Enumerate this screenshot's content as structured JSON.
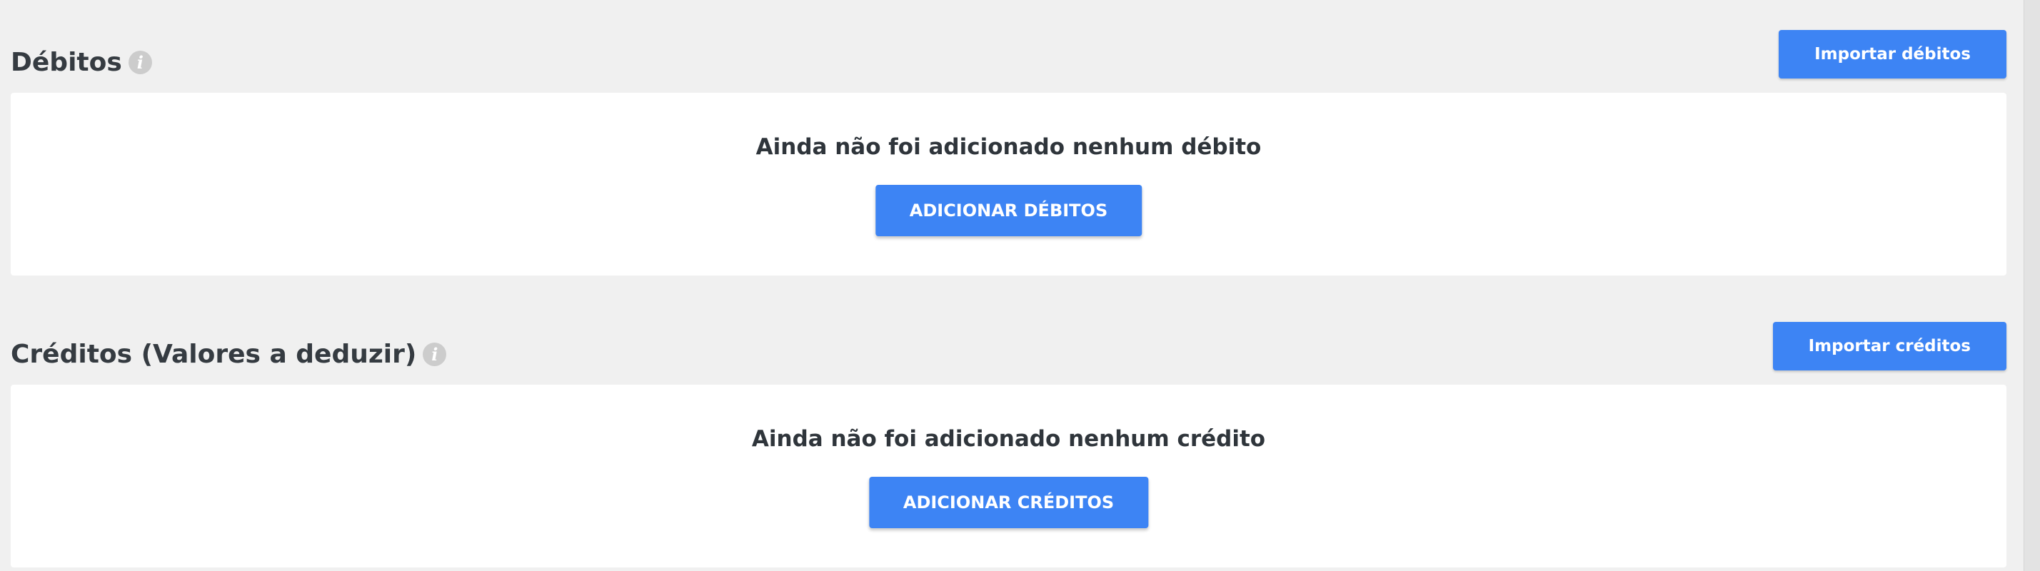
{
  "debits": {
    "title": "Débitos",
    "info_icon": "info-icon",
    "import_label": "Importar débitos",
    "empty_message": "Ainda não foi adicionado nenhum débito",
    "add_label": "ADICIONAR DÉBITOS"
  },
  "credits": {
    "title": "Créditos (Valores a deduzir)",
    "info_icon": "info-icon",
    "import_label": "Importar créditos",
    "empty_message": "Ainda não foi adicionado nenhum crédito",
    "add_label": "ADICIONAR CRÉDITOS"
  },
  "colors": {
    "background": "#f0f0f0",
    "panel": "#ffffff",
    "primary_button": "#3d84f4",
    "title_text": "#353b41",
    "info_icon": "#cccccc"
  }
}
